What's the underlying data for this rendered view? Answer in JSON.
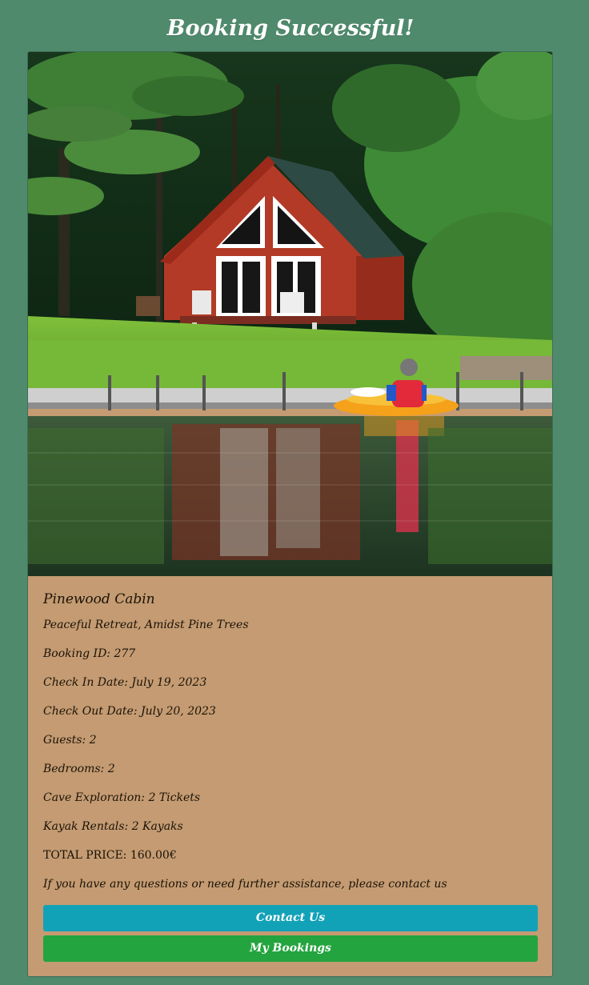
{
  "page": {
    "title": "Booking Successful!"
  },
  "booking": {
    "cabin_name": "Pinewood Cabin",
    "tagline": "Peaceful Retreat, Amidst Pine Trees",
    "booking_id": "Booking ID: 277",
    "check_in": "Check In Date: July 19, 2023",
    "check_out": "Check Out Date: July 20, 2023",
    "guests": "Guests: 2",
    "bedrooms": "Bedrooms: 2",
    "cave_exploration": "Cave Exploration: 2 Tickets",
    "kayak_rentals": "Kayak Rentals: 2 Kayaks",
    "total_price": "TOTAL PRICE: 160.00€",
    "contact_note": "If you have any questions or need further assistance, please contact us"
  },
  "buttons": {
    "contact_label": "Contact Us",
    "bookings_label": "My Bookings"
  },
  "colors": {
    "page_background": "#4f8a6c",
    "card_background": "#c49b72",
    "contact_button": "#12a2b8",
    "bookings_button": "#24a43f"
  }
}
